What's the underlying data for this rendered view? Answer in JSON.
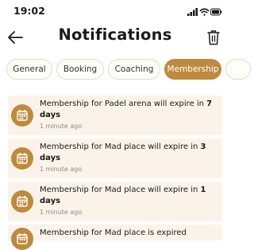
{
  "status_bar": {
    "time": "19:02"
  },
  "header": {
    "title": "Notifications"
  },
  "tabs": [
    {
      "label": "General",
      "active": false
    },
    {
      "label": "Booking",
      "active": false
    },
    {
      "label": "Coaching",
      "active": false
    },
    {
      "label": "Membership",
      "active": true
    }
  ],
  "notifications": [
    {
      "text": "Membership for Padel arena will expire in",
      "highlight": "7 days",
      "time": "1 minute ago"
    },
    {
      "text": "Membership for Mad place will expire in",
      "highlight": "3 days",
      "time": "1 minute ago"
    },
    {
      "text": "Membership for Mad place will expire in",
      "highlight": "1 days",
      "time": "1 minute ago"
    },
    {
      "text": "Membership for Mad place is expired",
      "highlight": "",
      "time": ""
    }
  ],
  "colors": {
    "accent": "#bd8a3e",
    "item_bg": "#fbf3ea",
    "tab_border": "#e5dbc6"
  },
  "icons": [
    "back-arrow-icon",
    "trash-icon",
    "calendar-icon",
    "signal-icon",
    "wifi-icon",
    "battery-icon"
  ]
}
